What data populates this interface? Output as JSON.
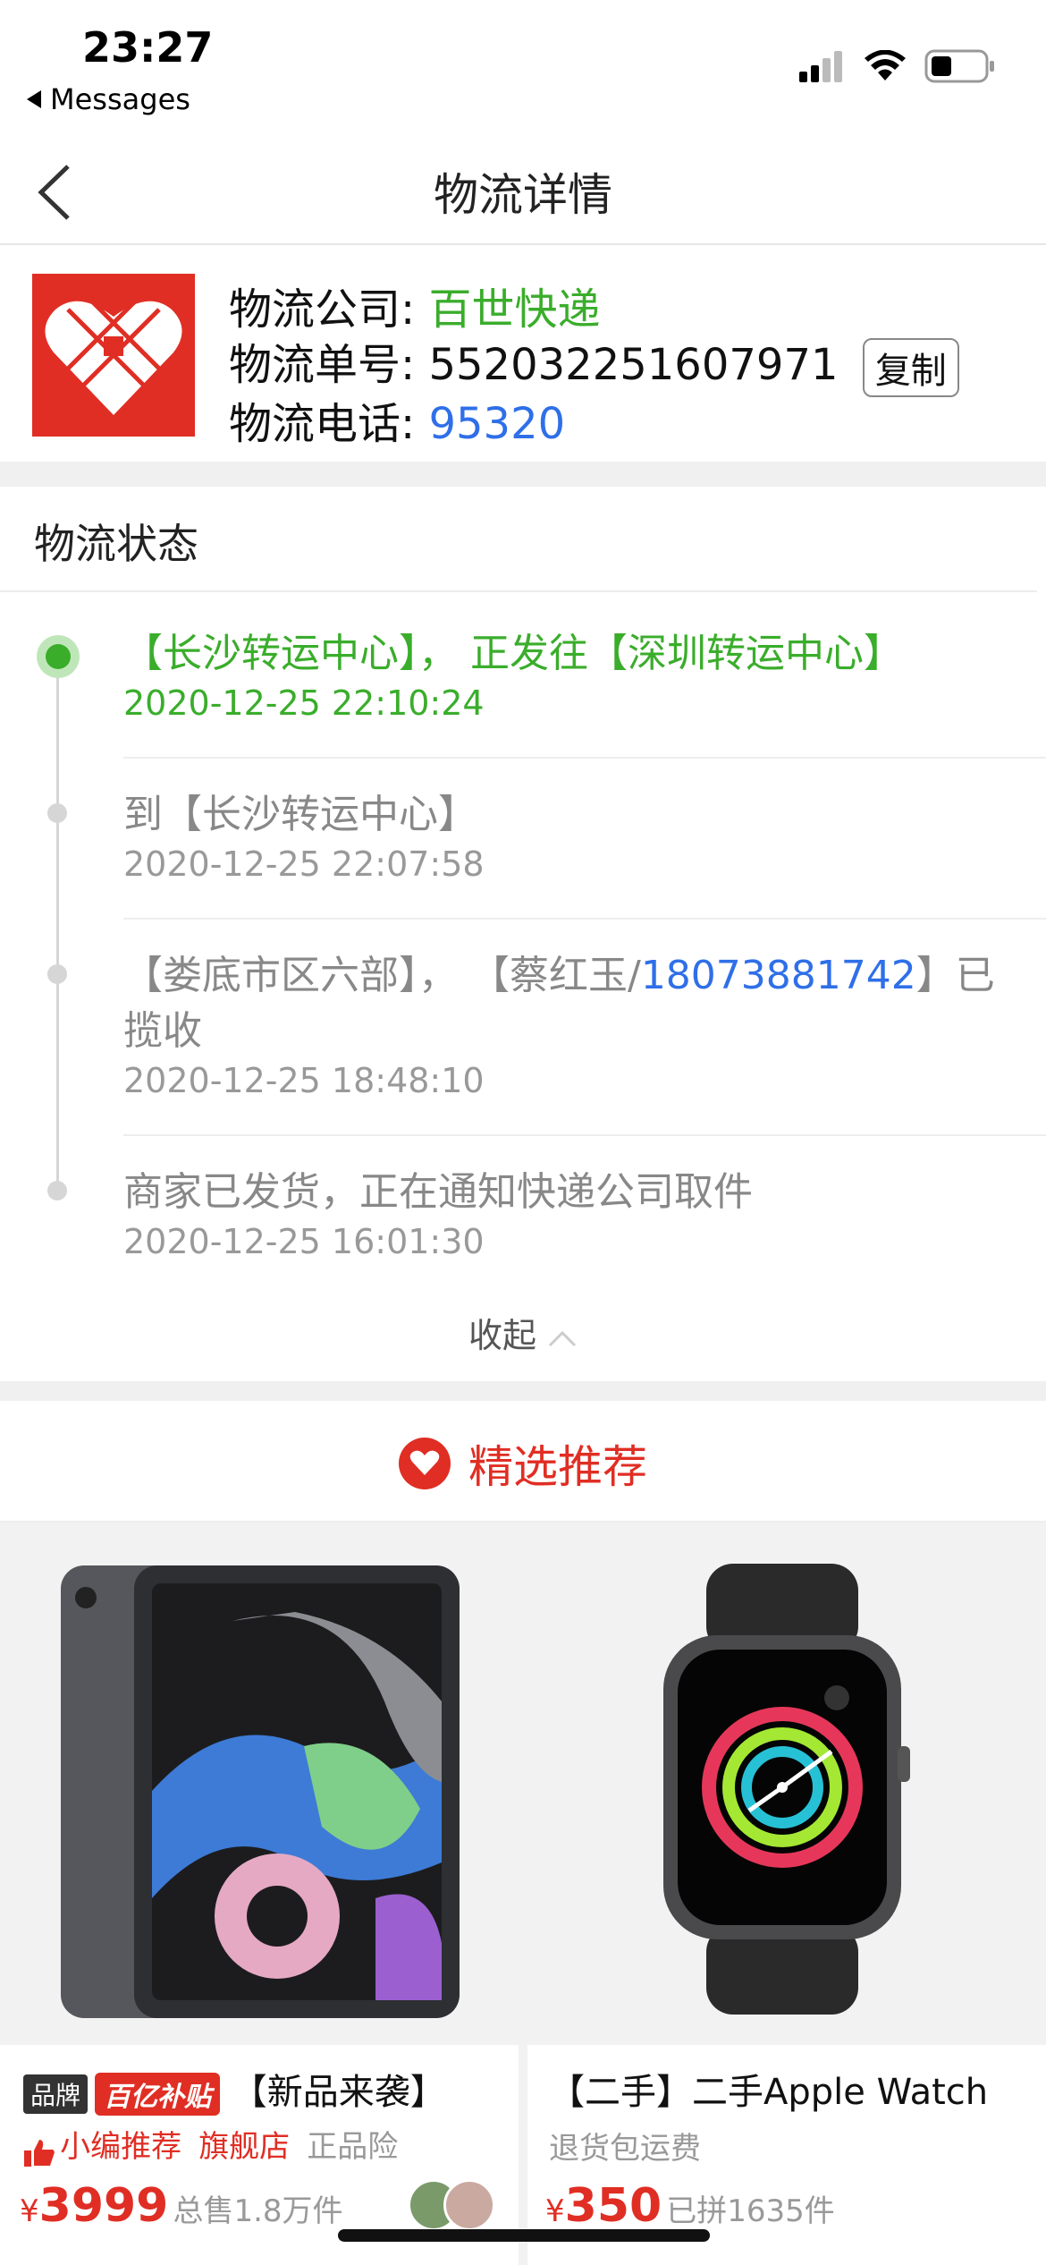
{
  "status_bar": {
    "time": "23:27",
    "back_app": "Messages"
  },
  "nav": {
    "title": "物流详情"
  },
  "courier": {
    "company_label": "物流公司:",
    "company_value": "百世快递",
    "tracking_label": "物流单号:",
    "tracking_value": "552032251607971",
    "copy_label": "复制",
    "phone_label": "物流电话:",
    "phone_value": "95320"
  },
  "status_section": {
    "title": "物流状态",
    "events": [
      {
        "text": "【长沙转运中心】， 正发往【深圳转运中心】",
        "time": "2020-12-25 22:10:24"
      },
      {
        "text": "到【长沙转运中心】",
        "time": "2020-12-25 22:07:58"
      },
      {
        "text_before": "【娄底市区六部】， 【蔡红玉/",
        "phone": "18073881742",
        "text_after": "】已揽收",
        "time": "2020-12-25 18:48:10"
      },
      {
        "text": "商家已发货，正在通知快递公司取件",
        "time": "2020-12-25 16:01:30"
      }
    ],
    "collapse_label": "收起"
  },
  "recommend": {
    "title": "精选推荐",
    "products": [
      {
        "brand_tag": "品牌",
        "subsidy_tag": "百亿补贴",
        "title": "【新品来袭】",
        "promo1": "小编推荐",
        "promo2": "旗舰店",
        "promo3": "正品险",
        "currency": "¥",
        "price": "3999",
        "sales": "总售1.8万件"
      },
      {
        "title": "【二手】二手Apple Watch",
        "promo1": "退货包运费",
        "currency": "¥",
        "price": "350",
        "sales": "已拼1635件"
      }
    ]
  },
  "colors": {
    "accent_red": "#e02e24",
    "status_green": "#3aad2b",
    "link_blue": "#2f6fe8"
  }
}
